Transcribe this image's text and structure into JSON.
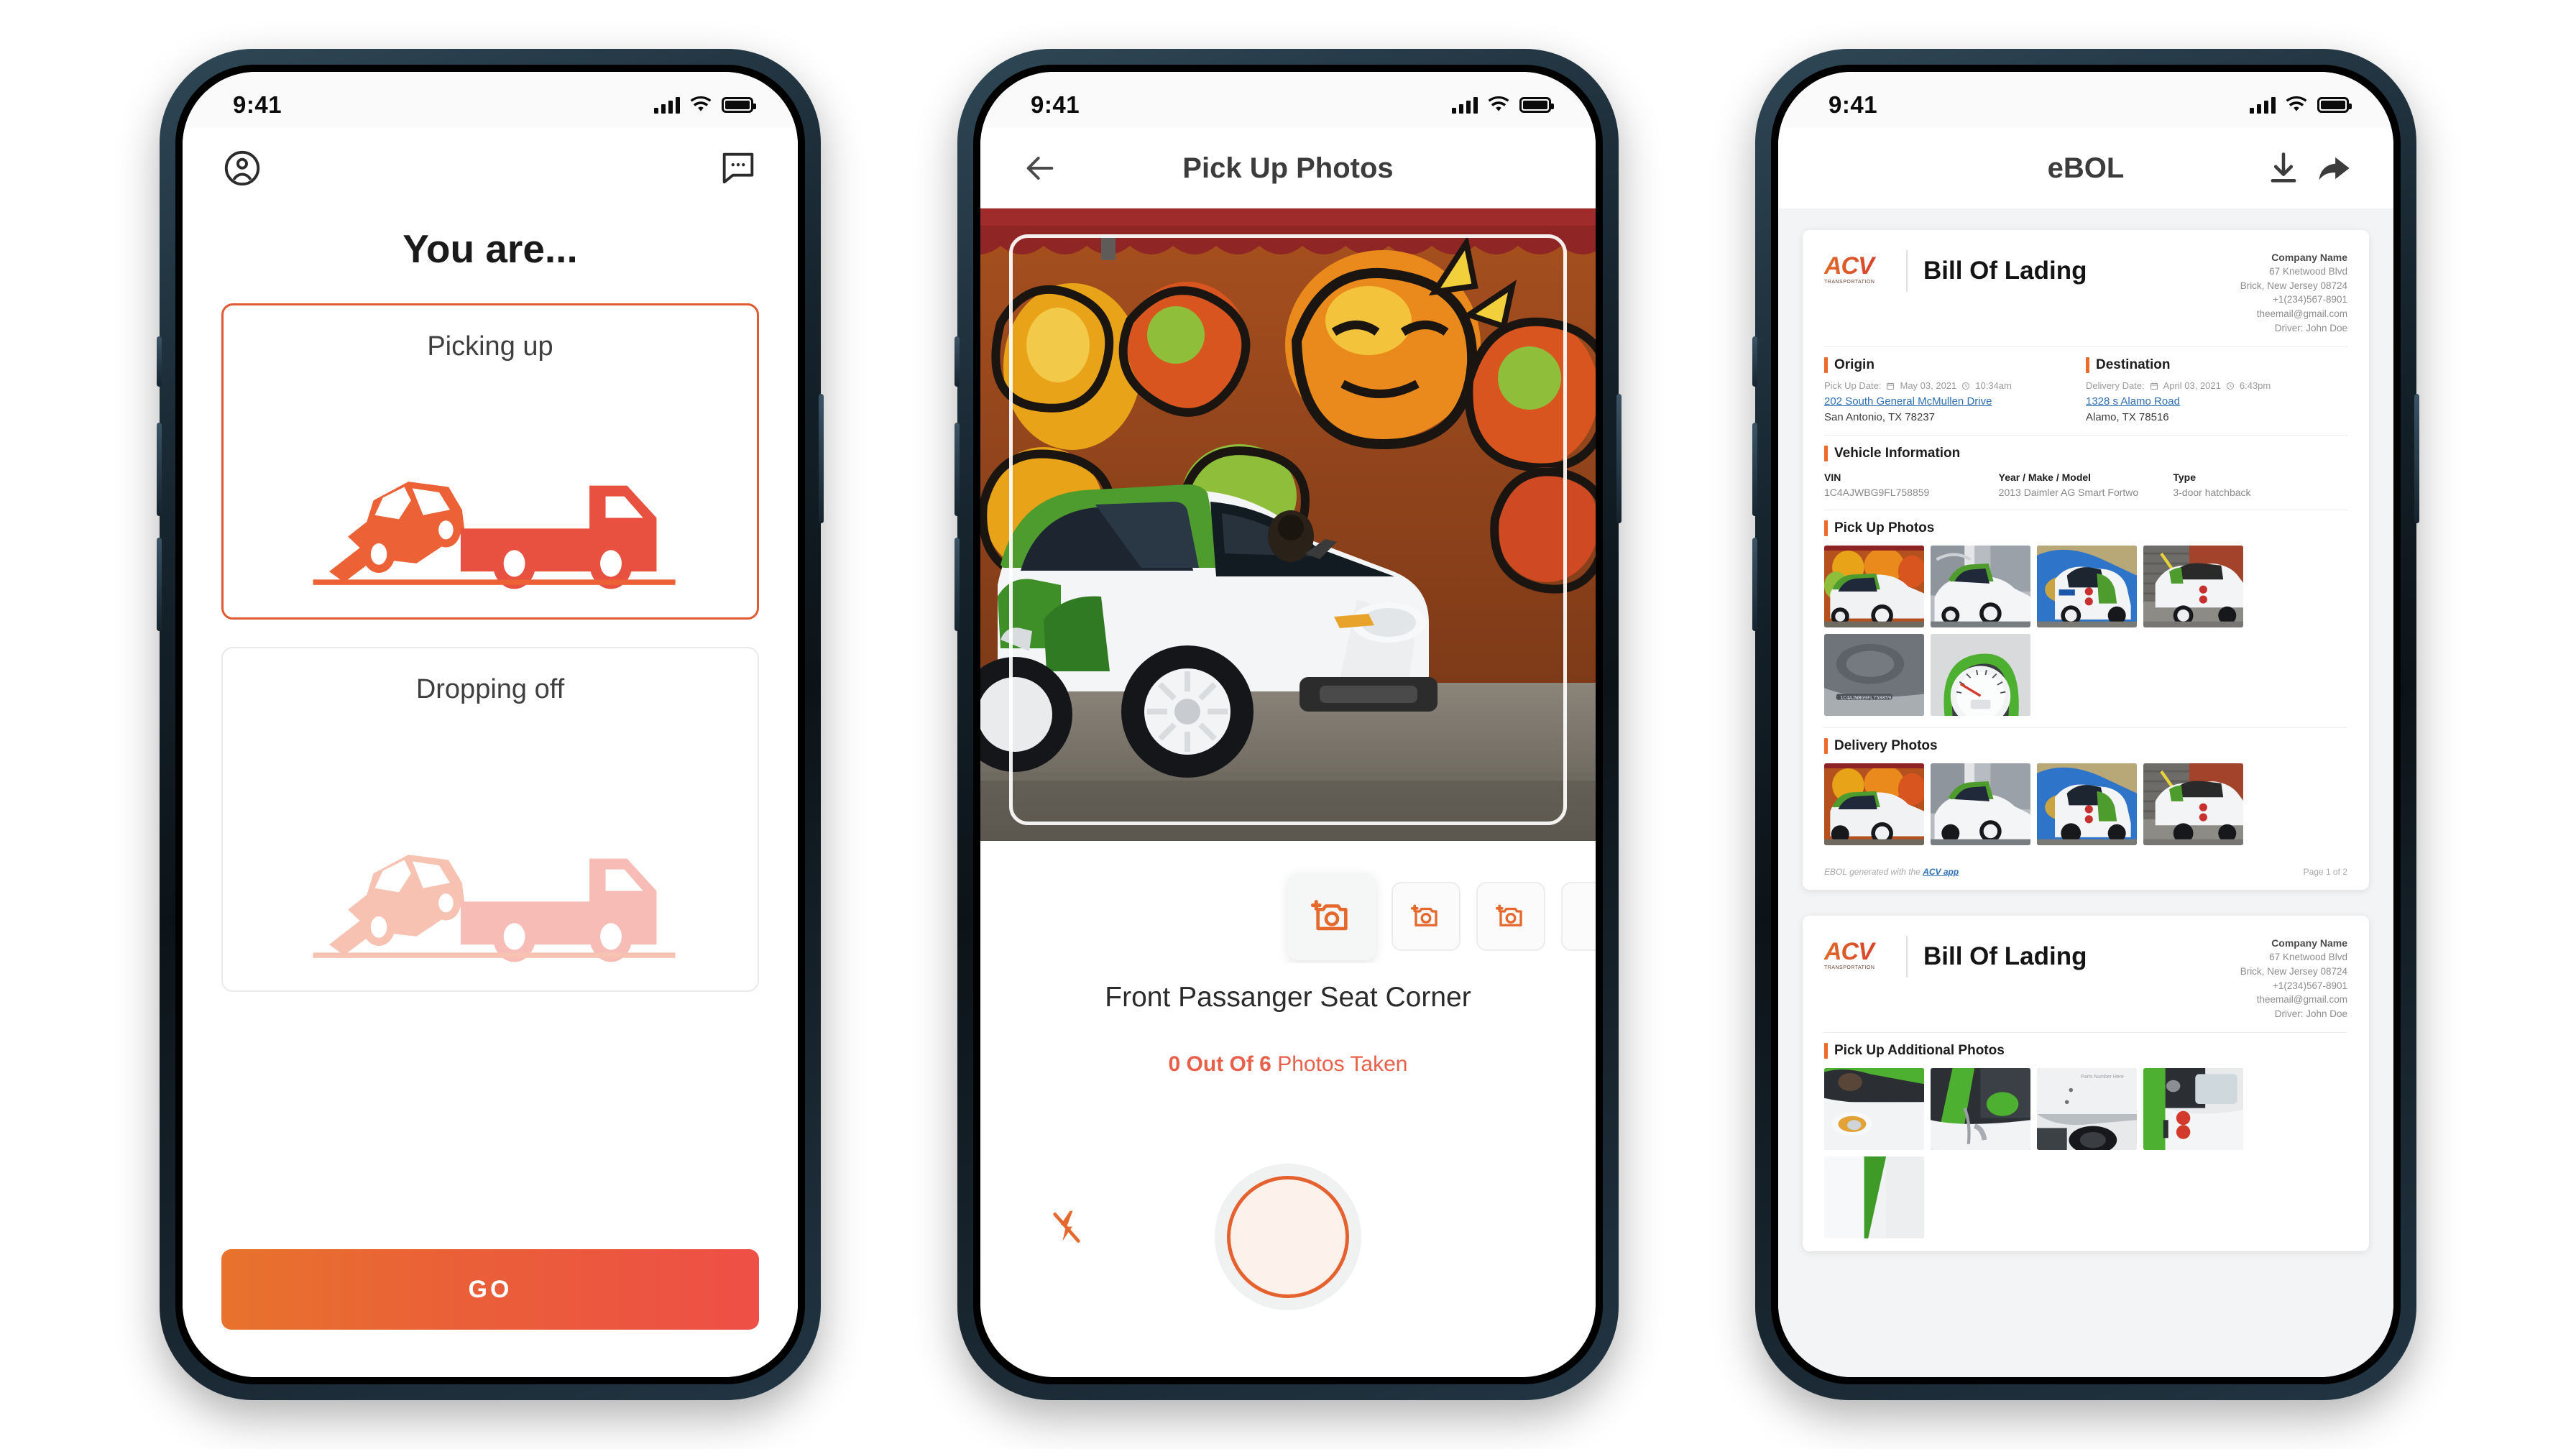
{
  "status_bar": {
    "time": "9:41",
    "signal_icon": "cellular-bars-icon",
    "wifi_icon": "wifi-icon",
    "battery_icon": "battery-full-icon"
  },
  "phone1": {
    "profile_icon": "account-circle-icon",
    "chat_icon": "chat-bubble-icon",
    "title": "You are...",
    "options": [
      {
        "label": "Picking up",
        "selected": true,
        "illustration": "tow-truck-loading-car-icon"
      },
      {
        "label": "Dropping off",
        "selected": false,
        "illustration": "tow-truck-unloading-car-icon"
      }
    ],
    "go_button": "GO",
    "accent_start": "#e8732c",
    "accent_end": "#ee4f46"
  },
  "phone2": {
    "back_icon": "arrow-left-icon",
    "title": "Pick Up Photos",
    "preview_alt": "white and green Smart Fortwo parked in front of graffiti mural",
    "framing_guide": "photo-framing-guide",
    "thumbnails": [
      {
        "icon": "add-photo-icon",
        "active": true
      },
      {
        "icon": "add-photo-icon",
        "active": false
      },
      {
        "icon": "add-photo-icon",
        "active": false
      },
      {
        "icon": "add-photo-icon",
        "active": false
      }
    ],
    "caption": "Front Passanger Seat Corner",
    "count_bold": "0 Out Of 6",
    "count_rest": " Photos Taken",
    "count_color": "#e8604a",
    "flash_icon": "flash-off-icon",
    "shutter_label": "shutter-button"
  },
  "phone3": {
    "title": "eBOL",
    "download_icon": "download-icon",
    "share_icon": "share-arrow-icon",
    "documents": [
      {
        "logo_text": "ACV",
        "logo_sub": "TRANSPORTATION",
        "title": "Bill Of Lading",
        "company": {
          "name": "Company Name",
          "address1": "67 Knetwood Blvd",
          "address2": "Brick, New Jersey 08724",
          "phone": "+1(234)567-8901",
          "email": "theemail@gmail.com",
          "driver": "Driver: John Doe"
        },
        "origin": {
          "heading": "Origin",
          "date_label": "Pick Up Date:",
          "date": "May 03, 2021",
          "time": "10:34am",
          "address": "202 South General McMullen Drive",
          "city": "San Antonio, TX 78237"
        },
        "destination": {
          "heading": "Destination",
          "date_label": "Delivery Date:",
          "date": "April 03, 2021",
          "time": "6:43pm",
          "address": "1328 s Alamo Road",
          "city": "Alamo, TX 78516"
        },
        "vehicle": {
          "heading": "Vehicle Information",
          "vin_label": "VIN",
          "vin": "1C4AJWBG9FL758859",
          "ymm_label": "Year / Make / Model",
          "ymm": "2013 Daimler AG Smart Fortwo",
          "type_label": "Type",
          "type": "3-door hatchback"
        },
        "pickup_photos_heading": "Pick Up Photos",
        "pickup_photos": [
          "car-front-graffiti-wall",
          "car-front-building-stairs",
          "car-rear-blue-sky",
          "car-rear-brick-wall",
          "vin-plate-dashboard",
          "odometer-gauge-cluster"
        ],
        "delivery_photos_heading": "Delivery Photos",
        "delivery_photos": [
          "car-front-graffiti-wall",
          "car-front-building-stairs",
          "car-rear-blue-sky",
          "car-rear-brick-wall"
        ],
        "footer_text": "EBOL generated with the ",
        "footer_link": "ACV app",
        "page_label": "Page 1 of 2"
      },
      {
        "logo_text": "ACV",
        "logo_sub": "TRANSPORTATION",
        "title": "Bill Of Lading",
        "company": {
          "name": "Company Name",
          "address1": "67 Knetwood Blvd",
          "address2": "Brick, New Jersey 08724",
          "phone": "+1(234)567-8901",
          "email": "theemail@gmail.com",
          "driver": "Driver: John Doe"
        },
        "additional_photos_heading": "Pick Up Additional Photos",
        "additional_photos": [
          "headlight-closeup",
          "green-mirror-door-closeup",
          "rear-wheel-closeup",
          "taillight-closeup",
          "green-stripe-panel-closeup"
        ]
      }
    ]
  }
}
